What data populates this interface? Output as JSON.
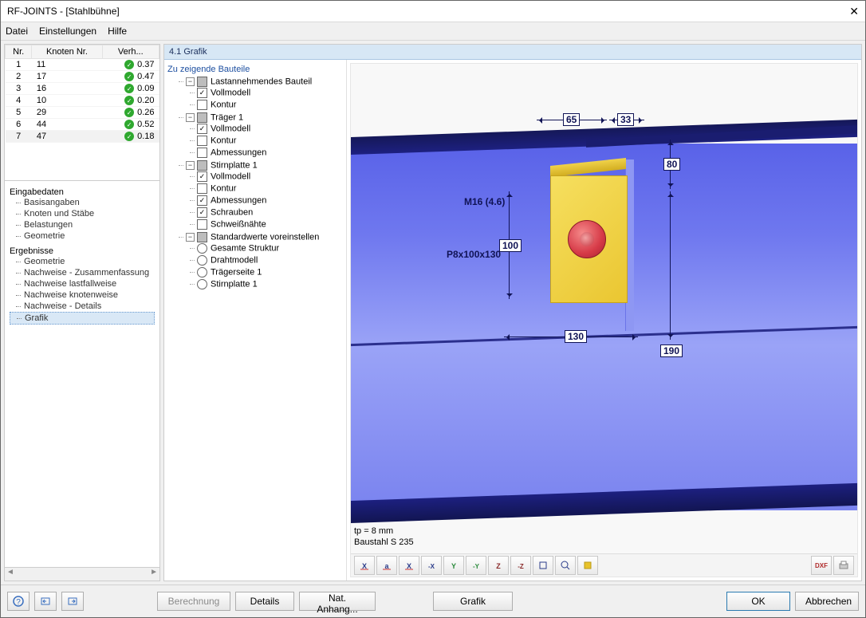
{
  "window": {
    "title": "RF-JOINTS - [Stahlbühne]"
  },
  "menu": {
    "file": "Datei",
    "settings": "Einstellungen",
    "help": "Hilfe"
  },
  "node_table": {
    "headers": {
      "nr": "Nr.",
      "knoten": "Knoten Nr.",
      "verh": "Verh..."
    },
    "rows": [
      {
        "nr": "1",
        "knoten": "11",
        "verh": "0.37"
      },
      {
        "nr": "2",
        "knoten": "17",
        "verh": "0.47"
      },
      {
        "nr": "3",
        "knoten": "16",
        "verh": "0.09"
      },
      {
        "nr": "4",
        "knoten": "10",
        "verh": "0.20"
      },
      {
        "nr": "5",
        "knoten": "29",
        "verh": "0.26"
      },
      {
        "nr": "6",
        "knoten": "44",
        "verh": "0.52"
      },
      {
        "nr": "7",
        "knoten": "47",
        "verh": "0.18"
      }
    ],
    "selected": 6
  },
  "nav": {
    "input_header": "Eingabedaten",
    "inputs": [
      "Basisangaben",
      "Knoten und Stäbe",
      "Belastungen",
      "Geometrie"
    ],
    "results_header": "Ergebnisse",
    "results": [
      "Geometrie",
      "Nachweise - Zusammenfassung",
      "Nachweise lastfallweise",
      "Nachweise knotenweise",
      "Nachweise - Details",
      "Grafik"
    ],
    "selected": "Grafik"
  },
  "panel_title": "4.1 Grafik",
  "components": {
    "header": "Zu zeigende Bauteile",
    "groups": [
      {
        "label": "Lastannehmendes Bauteil",
        "state": "mixed",
        "items": [
          {
            "label": "Vollmodell",
            "checked": true
          },
          {
            "label": "Kontur",
            "checked": false
          }
        ]
      },
      {
        "label": "Träger 1",
        "state": "mixed",
        "items": [
          {
            "label": "Vollmodell",
            "checked": true
          },
          {
            "label": "Kontur",
            "checked": false
          },
          {
            "label": "Abmessungen",
            "checked": false
          }
        ]
      },
      {
        "label": "Stirnplatte 1",
        "state": "mixed",
        "items": [
          {
            "label": "Vollmodell",
            "checked": true
          },
          {
            "label": "Kontur",
            "checked": false
          },
          {
            "label": "Abmessungen",
            "checked": true
          },
          {
            "label": "Schrauben",
            "checked": true
          },
          {
            "label": "Schweißnähte",
            "checked": false
          }
        ]
      },
      {
        "label": "Standardwerte voreinstellen",
        "state": "mixed",
        "type": "radio",
        "items": [
          {
            "label": "Gesamte Struktur"
          },
          {
            "label": "Drahtmodell"
          },
          {
            "label": "Trägerseite 1"
          },
          {
            "label": "Stirnplatte 1"
          }
        ]
      }
    ]
  },
  "dimensions": {
    "d65": "65",
    "d33": "33",
    "d80": "80",
    "d100": "100",
    "d130": "130",
    "d190": "190",
    "bolt_label": "M16 (4.6)",
    "plate_label": "P8x100x130"
  },
  "vp_status": {
    "line1": "tp = 8 mm",
    "line2": "Baustahl S 235"
  },
  "vp_toolbar": {
    "btns": [
      "X",
      "a",
      "X",
      "-X",
      "Y",
      "-Y",
      "Z",
      "-Z",
      "iso",
      "zoom",
      "color"
    ],
    "btn_dxf": "DXF",
    "btn_print": "print"
  },
  "footer": {
    "help": "?",
    "b1": "icon1",
    "b2": "icon2",
    "berechnung": "Berechnung",
    "details": "Details",
    "natanhang": "Nat. Anhang...",
    "grafik": "Grafik",
    "ok": "OK",
    "abbrechen": "Abbrechen"
  }
}
